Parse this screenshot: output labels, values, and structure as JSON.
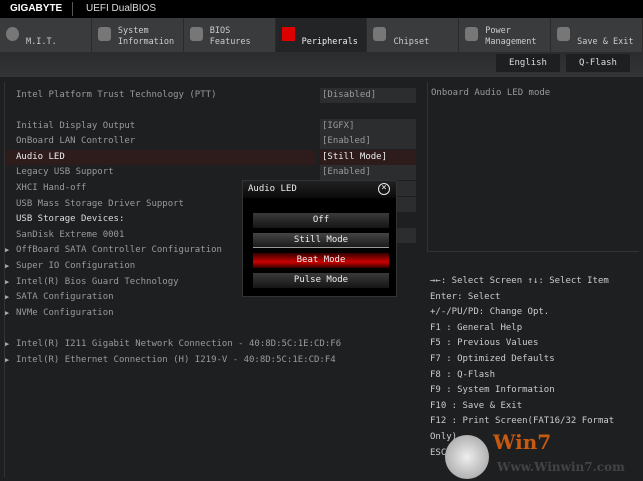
{
  "header": {
    "brand": "GIGABYTE",
    "title": "UEFI DualBIOS"
  },
  "tabs": [
    {
      "line1": "",
      "line2": "M.I.T.",
      "icon": "disc-icon"
    },
    {
      "line1": "System",
      "line2": "Information",
      "icon": "gear-icon"
    },
    {
      "line1": "BIOS",
      "line2": "Features",
      "icon": "chip-plus-icon"
    },
    {
      "line1": "",
      "line2": "Peripherals",
      "icon": "plug-icon",
      "active": true
    },
    {
      "line1": "",
      "line2": "Chipset",
      "icon": "chipset-icon"
    },
    {
      "line1": "Power",
      "line2": "Management",
      "icon": "power-leaf-icon"
    },
    {
      "line1": "",
      "line2": "Save & Exit",
      "icon": "exit-icon"
    }
  ],
  "toolbar": {
    "language": "English",
    "qflash": "Q-Flash"
  },
  "settings": [
    {
      "label": "Intel Platform Trust Technology (PTT)",
      "value": "[Disabled]"
    },
    {
      "label": "Initial Display Output",
      "value": "[IGFX]"
    },
    {
      "label": "OnBoard LAN Controller",
      "value": "[Enabled]"
    },
    {
      "label": "Audio LED",
      "value": "[Still Mode]"
    },
    {
      "label": "Legacy USB Support",
      "value": "[Enabled]"
    },
    {
      "label": "XHCI Hand-off",
      "value": ""
    },
    {
      "label": "USB Mass Storage Driver Support",
      "value": ""
    },
    {
      "label": "USB Storage Devices:"
    },
    {
      "label": "SanDisk Extreme 0001",
      "value": ""
    },
    {
      "label": "OffBoard SATA Controller Configuration"
    },
    {
      "label": "Super IO Configuration"
    },
    {
      "label": "Intel(R) Bios Guard Technology"
    },
    {
      "label": "SATA Configuration"
    },
    {
      "label": "NVMe Configuration"
    },
    {
      "label": "Intel(R) I211 Gigabit  Network Connection - 40:8D:5C:1E:CD:F6"
    },
    {
      "label": "Intel(R) Ethernet Connection (H) I219-V - 40:8D:5C:1E:CD:F4"
    }
  ],
  "help_text": "Onboard Audio LED mode",
  "keys": [
    "→←: Select Screen  ↑↓: Select Item",
    "Enter: Select",
    "+/-/PU/PD: Change Opt.",
    "F1  : General Help",
    "F5  : Previous Values",
    "F7  : Optimized Defaults",
    "F8  : Q-Flash",
    "F9  : System Information",
    "F10 : Save & Exit",
    "F12 : Print Screen(FAT16/32 Format Only)",
    "ESC : Exit"
  ],
  "dialog": {
    "title": "Audio LED",
    "options": [
      "Off",
      "Still Mode",
      "Beat Mode",
      "Pulse Mode"
    ],
    "current": "Still Mode",
    "highlighted": "Beat Mode"
  },
  "watermark": {
    "text": "Win7",
    "url": "Www.Winwin7.com"
  },
  "colors": {
    "accent": "#cc0000"
  }
}
